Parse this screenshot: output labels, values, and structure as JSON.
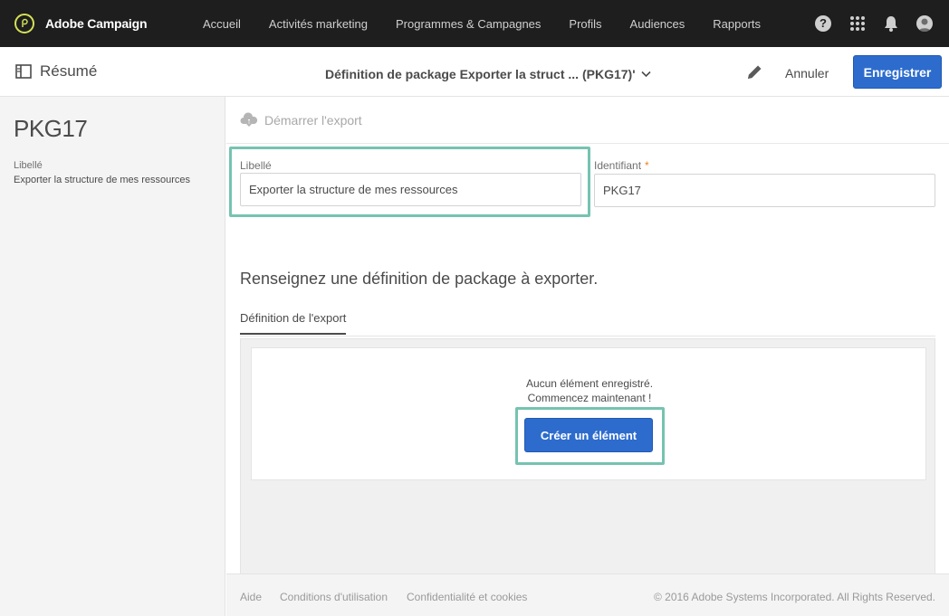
{
  "app": {
    "brand_name": "Adobe Campaign",
    "brand_color": "#d4e157",
    "logo_icon": "adobe-campaign-logo"
  },
  "topnav": {
    "items": [
      {
        "label": "Accueil"
      },
      {
        "label": "Activités marketing"
      },
      {
        "label": "Programmes & Campagnes"
      },
      {
        "label": "Profils"
      },
      {
        "label": "Audiences"
      },
      {
        "label": "Rapports"
      }
    ],
    "help_glyph": "?",
    "icons": [
      "help-icon",
      "apps-grid-icon",
      "bell-icon",
      "avatar-icon"
    ]
  },
  "subheader": {
    "summary_label": "Résumé",
    "doc_title": "Définition de package Exporter la struct ... (PKG17)'",
    "cancel_label": "Annuler",
    "save_label": "Enregistrer",
    "accent_color": "#2d6ccd"
  },
  "left_panel": {
    "title": "PKG17",
    "field_label": "Libellé",
    "field_value": "Exporter la structure de mes ressources"
  },
  "actions": {
    "export_label": "Démarrer l'export"
  },
  "form": {
    "label_field": {
      "label": "Libellé",
      "value": "Exporter la structure de mes ressources"
    },
    "id_field": {
      "label": "Identifiant",
      "required_marker": "*",
      "value": "PKG17"
    },
    "helper_text": "Renseignez une définition de package à exporter.",
    "tab_label": "Définition de l'export",
    "highlight_color": "#75c3b1"
  },
  "empty_state": {
    "line1": "Aucun élément enregistré.",
    "line2": "Commencez maintenant !",
    "create_label": "Créer un élément"
  },
  "footer": {
    "links": [
      {
        "label": "Aide"
      },
      {
        "label": "Conditions d'utilisation"
      },
      {
        "label": "Confidentialité et cookies"
      }
    ],
    "copyright": "© 2016 Adobe Systems Incorporated. All Rights Reserved."
  }
}
